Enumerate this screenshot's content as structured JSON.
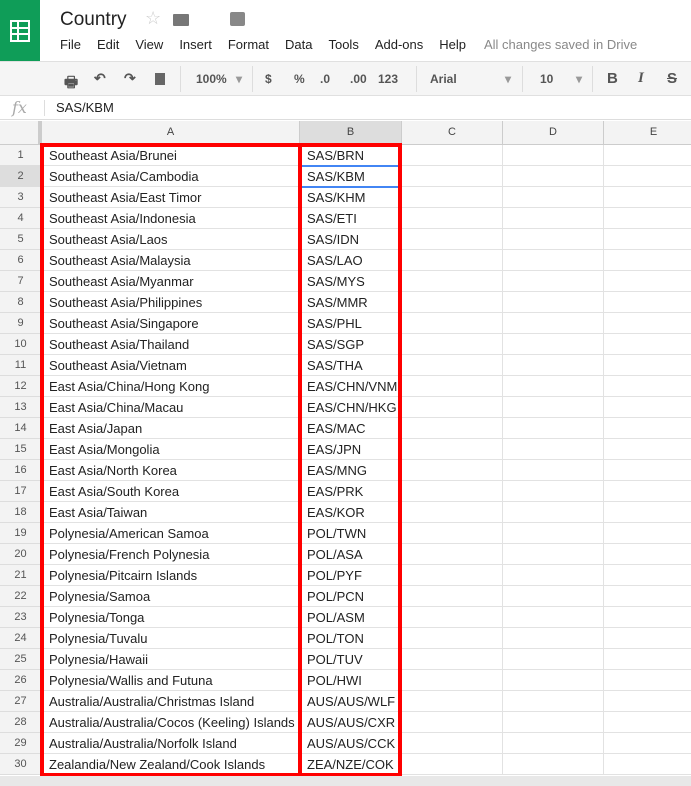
{
  "app": {
    "title": "Country",
    "save_status": "All changes saved in Drive"
  },
  "menu": [
    "File",
    "Edit",
    "View",
    "Insert",
    "Format",
    "Data",
    "Tools",
    "Add-ons",
    "Help"
  ],
  "toolbar": {
    "zoom": "100%",
    "currency": "$",
    "percent": "%",
    "dec_less": ".0",
    "dec_more": ".00",
    "format_more": "123",
    "font": "Arial",
    "font_size": "10",
    "bold": "B",
    "italic": "I",
    "strike": "S"
  },
  "formula_bar": {
    "fx": "fx",
    "value": "SAS/KBM"
  },
  "columns": [
    "A",
    "B",
    "C",
    "D",
    "E"
  ],
  "selected_cell": "B2",
  "rows": [
    [
      "Southeast Asia/Brunei",
      "SAS/BRN"
    ],
    [
      "Southeast Asia/Cambodia",
      "SAS/KBM"
    ],
    [
      "Southeast Asia/East Timor",
      "SAS/KHM"
    ],
    [
      "Southeast Asia/Indonesia",
      "SAS/ETI"
    ],
    [
      "Southeast Asia/Laos",
      "SAS/IDN"
    ],
    [
      "Southeast Asia/Malaysia",
      "SAS/LAO"
    ],
    [
      "Southeast Asia/Myanmar",
      "SAS/MYS"
    ],
    [
      "Southeast Asia/Philippines",
      "SAS/MMR"
    ],
    [
      "Southeast Asia/Singapore",
      "SAS/PHL"
    ],
    [
      "Southeast Asia/Thailand",
      "SAS/SGP"
    ],
    [
      "Southeast Asia/Vietnam",
      "SAS/THA"
    ],
    [
      "East Asia/China/Hong Kong",
      "EAS/CHN/VNM"
    ],
    [
      "East Asia/China/Macau",
      "EAS/CHN/HKG"
    ],
    [
      "East Asia/Japan",
      "EAS/MAC"
    ],
    [
      "East Asia/Mongolia",
      "EAS/JPN"
    ],
    [
      "East Asia/North Korea",
      "EAS/MNG"
    ],
    [
      "East Asia/South Korea",
      "EAS/PRK"
    ],
    [
      "East Asia/Taiwan",
      "EAS/KOR"
    ],
    [
      "Polynesia/American Samoa",
      "POL/TWN"
    ],
    [
      "Polynesia/French Polynesia",
      "POL/ASA"
    ],
    [
      "Polynesia/Pitcairn Islands",
      "POL/PYF"
    ],
    [
      "Polynesia/Samoa",
      "POL/PCN"
    ],
    [
      "Polynesia/Tonga",
      "POL/ASM"
    ],
    [
      "Polynesia/Tuvalu",
      "POL/TON"
    ],
    [
      "Polynesia/Hawaii",
      "POL/TUV"
    ],
    [
      "Polynesia/Wallis and Futuna",
      "POL/HWI"
    ],
    [
      "Australia/Australia/Christmas Island",
      "AUS/AUS/WLF"
    ],
    [
      "Australia/Australia/Cocos (Keeling) Islands",
      "AUS/AUS/CXR"
    ],
    [
      "Australia/Australia/Norfolk Island",
      "AUS/AUS/CCK"
    ],
    [
      "Zealandia/New Zealand/Cook Islands",
      "ZEA/NZE/COK"
    ]
  ],
  "colors": {
    "brand": "#0f9d58",
    "highlight": "#ff0000",
    "selection": "#4285f4"
  }
}
